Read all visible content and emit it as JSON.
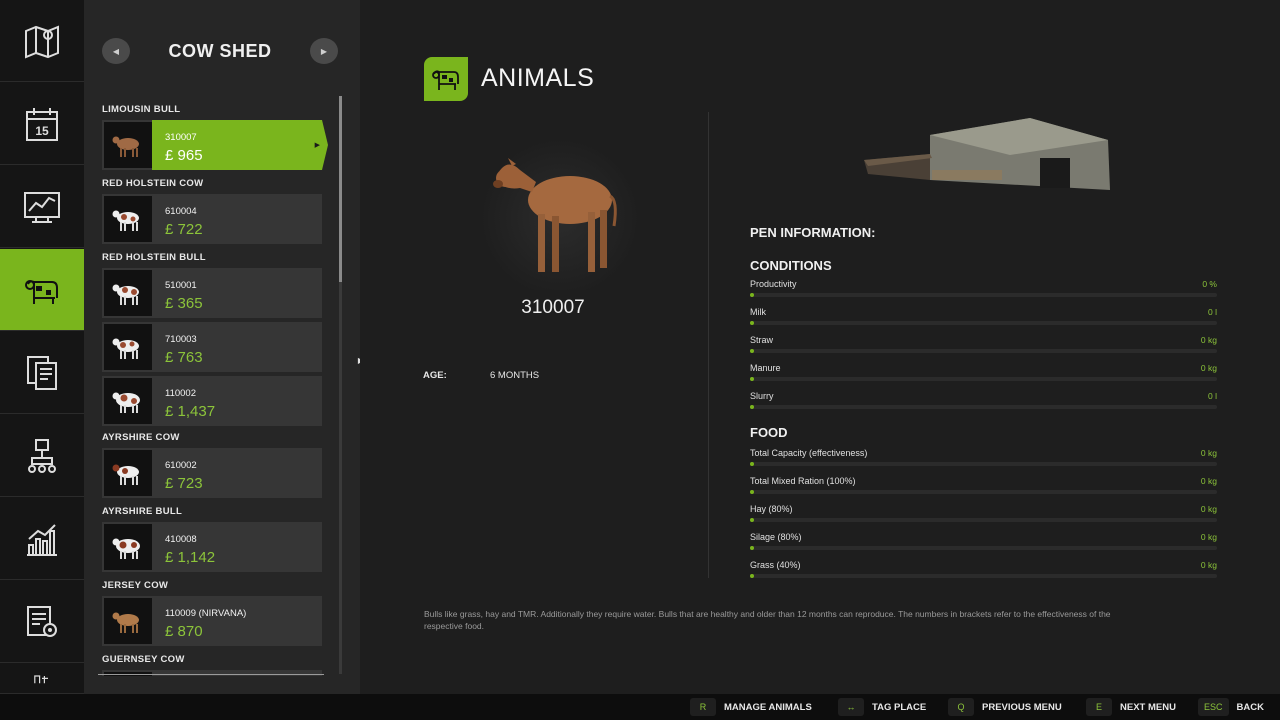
{
  "shed": {
    "title": "COW SHED",
    "prev": "◀",
    "next": "▶"
  },
  "nav": [
    {
      "icon": "map-icon"
    },
    {
      "icon": "calendar-icon",
      "text": "15"
    },
    {
      "icon": "price-chart-icon"
    },
    {
      "icon": "animals-icon"
    },
    {
      "icon": "contracts-icon"
    },
    {
      "icon": "production-icon"
    },
    {
      "icon": "statistics-icon"
    },
    {
      "icon": "garage-icon"
    },
    {
      "icon": "help-icon"
    }
  ],
  "groups": [
    {
      "title": "LIMOUSIN BULL"
    },
    {
      "title": "RED HOLSTEIN COW"
    },
    {
      "title": "RED HOLSTEIN BULL"
    },
    {
      "title": "AYRSHIRE COW"
    },
    {
      "title": "AYRSHIRE BULL"
    },
    {
      "title": "JERSEY COW"
    },
    {
      "title": "GUERNSEY COW"
    }
  ],
  "animals": [
    {
      "id": "310007",
      "price": "£ 965",
      "selected": true
    },
    {
      "id": "610004",
      "price": "£ 722"
    },
    {
      "id": "510001",
      "price": "£ 365"
    },
    {
      "id": "710003",
      "price": "£ 763"
    },
    {
      "id": "110002",
      "price": "£ 1,437"
    },
    {
      "id": "610002",
      "price": "£ 723"
    },
    {
      "id": "410008",
      "price": "£ 1,142"
    },
    {
      "id": "110009 (NIRVANA)",
      "price": "£ 870"
    }
  ],
  "section": {
    "title": "ANIMALS"
  },
  "selected_animal": {
    "id": "310007",
    "age_label": "AGE:",
    "age": "6 MONTHS"
  },
  "pen": {
    "title": "PEN INFORMATION:",
    "conditions_title": "CONDITIONS",
    "conditions": [
      {
        "label": "Productivity",
        "value": "0 %",
        "level": 0
      },
      {
        "label": "Milk",
        "value": "0 l",
        "level": 0
      },
      {
        "label": "Straw",
        "value": "0 kg",
        "level": 0
      },
      {
        "label": "Manure",
        "value": "0 kg",
        "level": 0
      },
      {
        "label": "Slurry",
        "value": "0 l",
        "level": 0
      }
    ],
    "food_title": "FOOD",
    "food": [
      {
        "label": "Total Capacity (effectiveness)",
        "value": "0 kg",
        "level": 0
      },
      {
        "label": "Total Mixed Ration (100%)",
        "value": "0 kg",
        "level": 0
      },
      {
        "label": "Hay (80%)",
        "value": "0 kg",
        "level": 0
      },
      {
        "label": "Silage (80%)",
        "value": "0 kg",
        "level": 0
      },
      {
        "label": "Grass (40%)",
        "value": "0 kg",
        "level": 0
      }
    ]
  },
  "note": "Bulls like grass, hay and TMR. Additionally they require water. Bulls that are healthy and older than 12 months can reproduce. The numbers in brackets refer to the effectiveness of the respective food.",
  "hints": [
    {
      "key": "R",
      "label": "MANAGE ANIMALS"
    },
    {
      "key": "↔",
      "label": "TAG PLACE"
    },
    {
      "key": "Q",
      "label": "PREVIOUS MENU"
    },
    {
      "key": "E",
      "label": "NEXT MENU"
    },
    {
      "key": "ESC",
      "label": "BACK"
    }
  ],
  "colors": {
    "accent": "#7ab51d",
    "value_green": "#8cc43a",
    "panel": "#262626",
    "background": "#1e1e1e"
  }
}
